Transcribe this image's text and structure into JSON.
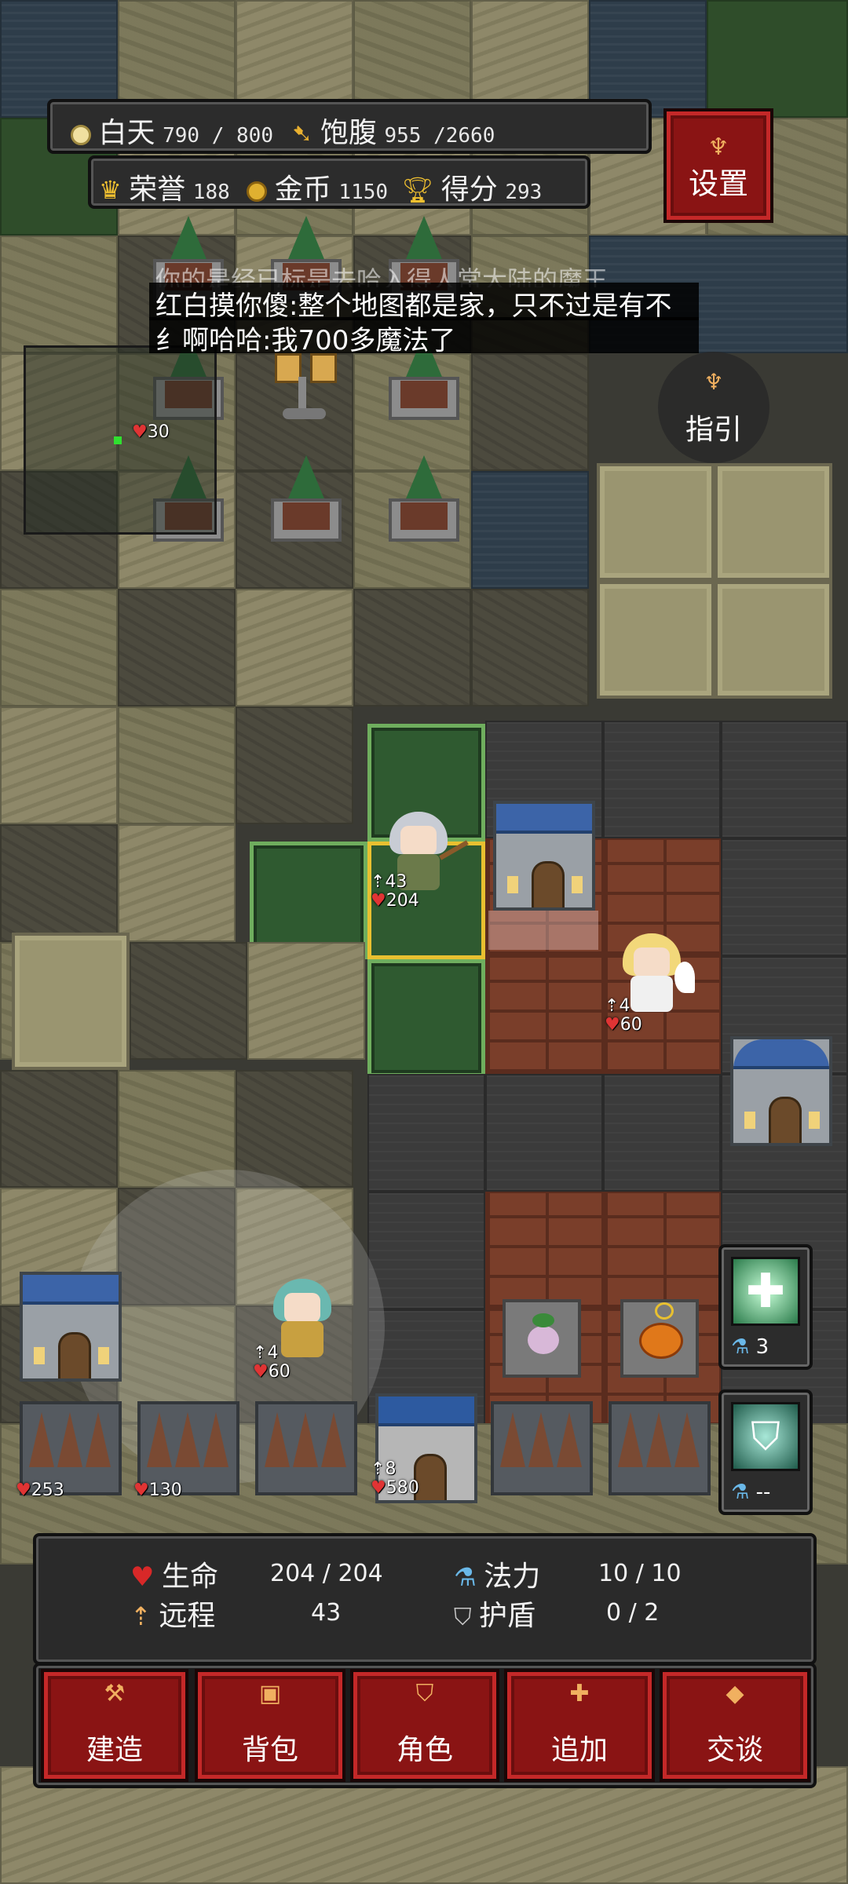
{
  "stats_bar": {
    "day_label": "白天",
    "day_value": "790 / 800",
    "hunger_label": "饱腹",
    "hunger_value": "955 /2660",
    "honor_label": "荣誉",
    "honor_value": "188",
    "gold_label": "金币",
    "gold_value": "1150",
    "score_label": "得分",
    "score_value": "293"
  },
  "settings_button": {
    "label": "设置"
  },
  "guide_button": {
    "label": "指引"
  },
  "chat": {
    "line_faded": "你的是经已标是去哈入得人常大陆的魔王",
    "line1": "红白摸你傻:整个地图都是家，只不过是有不",
    "line2": "纟啊哈哈:我700多魔法了"
  },
  "minimap": {
    "hp_label": "30"
  },
  "units": {
    "selected_hero": {
      "attack": "43",
      "hp": "204"
    },
    "angel": {
      "attack": "4",
      "hp": "60"
    },
    "teal_girl": {
      "attack": "4",
      "hp": "60"
    },
    "castle_unit": {
      "attack": "8",
      "hp": "580"
    }
  },
  "structures": {
    "spikes_left_hp": "253",
    "spikes_mid_hp": "130"
  },
  "skills": [
    {
      "icon": "holy-cross-icon",
      "mana_cost": "3"
    },
    {
      "icon": "shield-skill-icon",
      "mana_cost": "--"
    }
  ],
  "status_panel": {
    "hp_label": "生命",
    "hp_value": "204 / 204",
    "mana_label": "法力",
    "mana_value": "10 / 10",
    "range_label": "远程",
    "range_value": "43",
    "shield_label": "护盾",
    "shield_value": "0 / 2"
  },
  "action_bar": [
    {
      "label": "建造",
      "icon": "hammer-icon"
    },
    {
      "label": "背包",
      "icon": "bag-icon"
    },
    {
      "label": "角色",
      "icon": "shield-icon"
    },
    {
      "label": "追加",
      "icon": "plus-icon"
    },
    {
      "label": "交谈",
      "icon": "speech-icon"
    }
  ],
  "colors": {
    "button_red": "#8a1414",
    "panel_dark": "#2c2c2c",
    "selection_gold": "#e8c030",
    "selection_green": "#6fae5e"
  }
}
